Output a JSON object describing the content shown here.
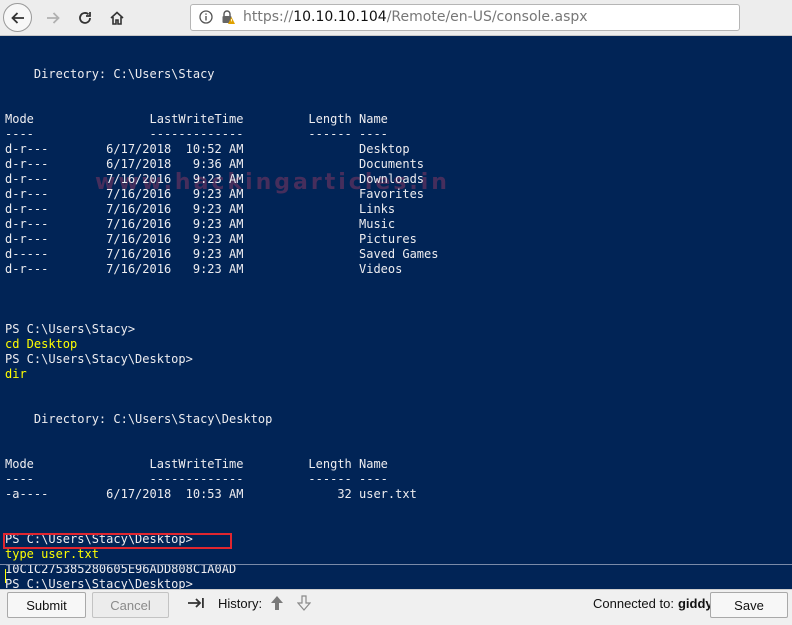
{
  "browser": {
    "url_scheme": "https://",
    "url_host": "10.10.10.104",
    "url_path": "/Remote/en-US/console.aspx"
  },
  "console": {
    "lines": [
      {
        "text": "",
        "type": "out"
      },
      {
        "text": "    Directory: C:\\Users\\Stacy",
        "type": "out"
      },
      {
        "text": "",
        "type": "out"
      },
      {
        "text": "",
        "type": "out"
      },
      {
        "text": "Mode                LastWriteTime         Length Name",
        "type": "out"
      },
      {
        "text": "----                -------------         ------ ----",
        "type": "out"
      },
      {
        "text": "d-r---        6/17/2018  10:52 AM                Desktop",
        "type": "out"
      },
      {
        "text": "d-r---        6/17/2018   9:36 AM                Documents",
        "type": "out"
      },
      {
        "text": "d-r---        7/16/2016   9:23 AM                Downloads",
        "type": "out"
      },
      {
        "text": "d-r---        7/16/2016   9:23 AM                Favorites",
        "type": "out"
      },
      {
        "text": "d-r---        7/16/2016   9:23 AM                Links",
        "type": "out"
      },
      {
        "text": "d-r---        7/16/2016   9:23 AM                Music",
        "type": "out"
      },
      {
        "text": "d-r---        7/16/2016   9:23 AM                Pictures",
        "type": "out"
      },
      {
        "text": "d-----        7/16/2016   9:23 AM                Saved Games",
        "type": "out"
      },
      {
        "text": "d-r---        7/16/2016   9:23 AM                Videos",
        "type": "out"
      },
      {
        "text": "",
        "type": "out"
      },
      {
        "text": "",
        "type": "out"
      },
      {
        "text": "",
        "type": "out"
      },
      {
        "text": "PS C:\\Users\\Stacy>",
        "type": "out"
      },
      {
        "text": "cd Desktop",
        "type": "cmd"
      },
      {
        "text": "PS C:\\Users\\Stacy\\Desktop>",
        "type": "out"
      },
      {
        "text": "dir",
        "type": "cmd"
      },
      {
        "text": "",
        "type": "out"
      },
      {
        "text": "",
        "type": "out"
      },
      {
        "text": "    Directory: C:\\Users\\Stacy\\Desktop",
        "type": "out"
      },
      {
        "text": "",
        "type": "out"
      },
      {
        "text": "",
        "type": "out"
      },
      {
        "text": "Mode                LastWriteTime         Length Name",
        "type": "out"
      },
      {
        "text": "----                -------------         ------ ----",
        "type": "out"
      },
      {
        "text": "-a----        6/17/2018  10:53 AM             32 user.txt",
        "type": "out"
      },
      {
        "text": "",
        "type": "out"
      },
      {
        "text": "",
        "type": "out"
      },
      {
        "text": "PS C:\\Users\\Stacy\\Desktop>",
        "type": "out"
      },
      {
        "text": "type user.txt",
        "type": "cmd"
      },
      {
        "text": "10C1C275385280605E96ADD808C1A0AD",
        "type": "out"
      },
      {
        "text": "PS C:\\Users\\Stacy\\Desktop>",
        "type": "out"
      }
    ],
    "watermark": "www.hackingarticles.in"
  },
  "toolbar": {
    "submit_label": "Submit",
    "cancel_label": "Cancel",
    "history_label": "History:",
    "connected_label": "Connected to:",
    "connected_user": "giddy",
    "save_label": "Save"
  },
  "colors": {
    "console_bg": "#012456",
    "console_text": "#eeedf0",
    "command_text": "#ffff00",
    "highlight_box": "#e0262f"
  }
}
